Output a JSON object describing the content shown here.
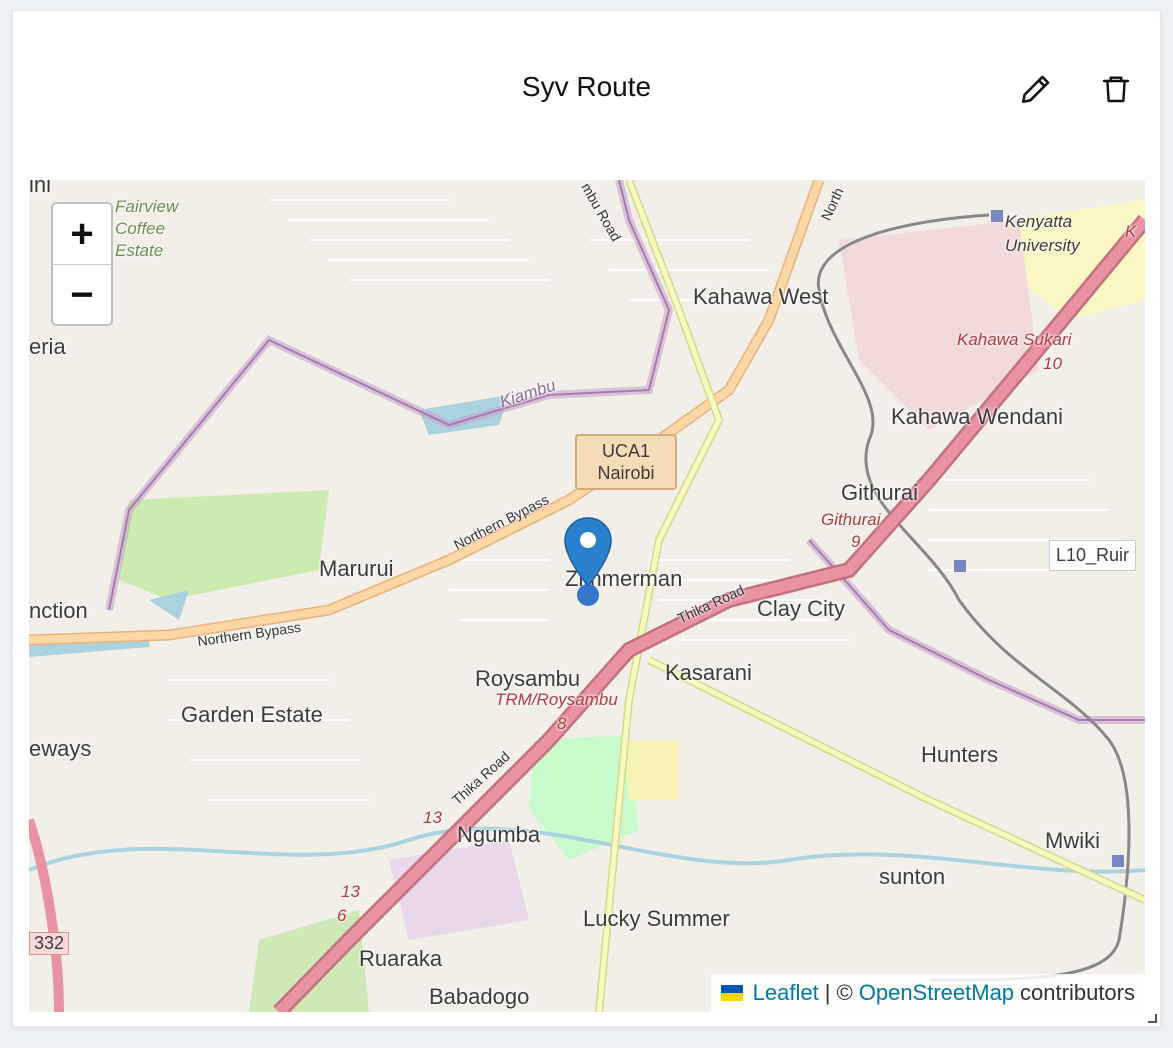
{
  "card": {
    "title": "Syv Route"
  },
  "icons": {
    "edit": "pencil-icon",
    "delete": "trash-icon"
  },
  "map": {
    "zoom_in": "+",
    "zoom_out": "−",
    "shield_line1": "UCA1",
    "shield_line2": "Nairobi",
    "labels": {
      "fairview": "Fairview Coffee Estate",
      "kenyatta": "Kenyatta University",
      "kahawa_west": "Kahawa West",
      "kahawa_sukari": "Kahawa Sukari",
      "kahawa_sukari_num": "10",
      "kahawa_wendani": "Kahawa Wendani",
      "kiambu": "Kiambu",
      "githurai": "Githurai",
      "githurai_red": "Githurai",
      "githurai_num": "9",
      "l10": "L10_Ruir",
      "marurui": "Marurui",
      "zimmerman": "Zimmerman",
      "clay_city": "Clay City",
      "kasarani": "Kasarani",
      "roysambu": "Roysambu",
      "trm": "TRM/Roysambu",
      "trm_num": "8",
      "garden_estate": "Garden Estate",
      "hunters": "Hunters",
      "mwiki": "Mwiki",
      "ngumba": "Ngumba",
      "sunton": "sunton",
      "lucky_summer": "Lucky Summer",
      "ruaraka": "Ruaraka",
      "babadogo": "Babadogo",
      "eria": "eria",
      "nction": "nction",
      "eways": "eways",
      "ini": "ini",
      "num_332": "332",
      "num_13a": "13",
      "num_13b": "13",
      "num_6": "6",
      "northern_bypass_1": "Northern Bypass",
      "northern_bypass_2": "Northern Bypass",
      "thika_road_1": "Thika Road",
      "thika_road_2": "Thika Road",
      "kiambu_road": "mbu Road",
      "north": "North",
      "k_label": "K"
    },
    "attribution": {
      "leaflet": "Leaflet",
      "separator": "| ©",
      "osm": "OpenStreetMap",
      "contributors": "contributors"
    }
  },
  "colors": {
    "trunk_road": "#e892a2",
    "primary_road": "#fcd6a4",
    "secondary_road": "#f7fabf",
    "boundary": "#a87bb0",
    "water": "#aad3df",
    "park": "#c8facc",
    "marker": "#2a81cb"
  }
}
